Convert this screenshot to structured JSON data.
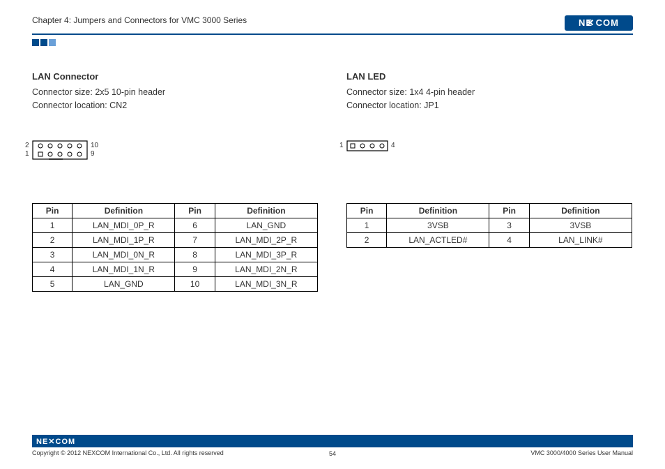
{
  "header": {
    "chapter": "Chapter 4: Jumpers and Connectors for VMC 3000 Series",
    "brand": "NEXCOM"
  },
  "left": {
    "title": "LAN Connector",
    "size_label": "Connector size: 2x5 10-pin header",
    "location_label": "Connector location: CN2",
    "diagram": {
      "l2": "2",
      "l1": "1",
      "r10": "10",
      "r9": "9"
    },
    "table": {
      "headers": {
        "pin": "Pin",
        "def": "Definition"
      },
      "rows": [
        {
          "p1": "1",
          "d1": "LAN_MDI_0P_R",
          "p2": "6",
          "d2": "LAN_GND"
        },
        {
          "p1": "2",
          "d1": "LAN_MDI_1P_R",
          "p2": "7",
          "d2": "LAN_MDI_2P_R"
        },
        {
          "p1": "3",
          "d1": "LAN_MDI_0N_R",
          "p2": "8",
          "d2": "LAN_MDI_3P_R"
        },
        {
          "p1": "4",
          "d1": "LAN_MDI_1N_R",
          "p2": "9",
          "d2": "LAN_MDI_2N_R"
        },
        {
          "p1": "5",
          "d1": "LAN_GND",
          "p2": "10",
          "d2": "LAN_MDI_3N_R"
        }
      ]
    }
  },
  "right": {
    "title": "LAN LED",
    "size_label": "Connector size: 1x4 4-pin header",
    "location_label": "Connector location: JP1",
    "diagram": {
      "l1": "1",
      "r4": "4"
    },
    "table": {
      "headers": {
        "pin": "Pin",
        "def": "Definition"
      },
      "rows": [
        {
          "p1": "1",
          "d1": "3VSB",
          "p2": "3",
          "d2": "3VSB"
        },
        {
          "p1": "2",
          "d1": "LAN_ACTLED#",
          "p2": "4",
          "d2": "LAN_LINK#"
        }
      ]
    }
  },
  "footer": {
    "copyright": "Copyright © 2012 NEXCOM International Co., Ltd. All rights reserved",
    "page": "54",
    "doc": "VMC 3000/4000 Series User Manual",
    "brand": "NEXCOM"
  }
}
